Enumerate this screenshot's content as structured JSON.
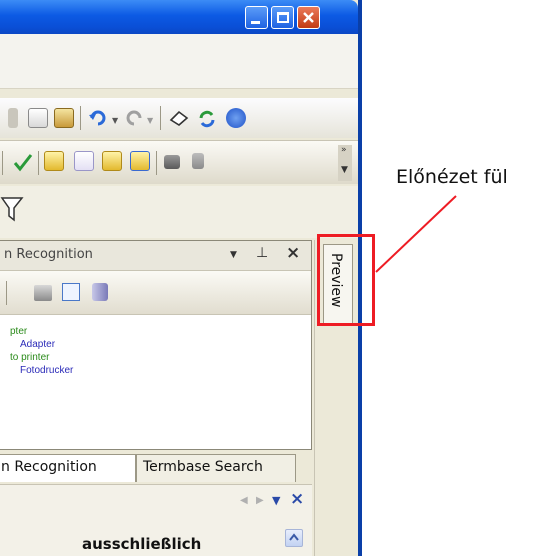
{
  "panel": {
    "title": "n Recognition"
  },
  "entries": [
    {
      "text": "pter",
      "color": "#2a8a1a"
    },
    {
      "text": "Adapter",
      "color": "#2b2bb8"
    },
    {
      "text": "to printer",
      "color": "#2a8a1a"
    },
    {
      "text": "Fotodrucker",
      "color": "#2b2bb8"
    }
  ],
  "tabs": {
    "tm": "n Recognition",
    "termbase": "Termbase Search"
  },
  "bottom": {
    "text": "ausschließlich"
  },
  "side": {
    "preview_label": "Preview"
  },
  "annotation": {
    "label": "Előnézet fül",
    "color": "#ee1c24"
  }
}
